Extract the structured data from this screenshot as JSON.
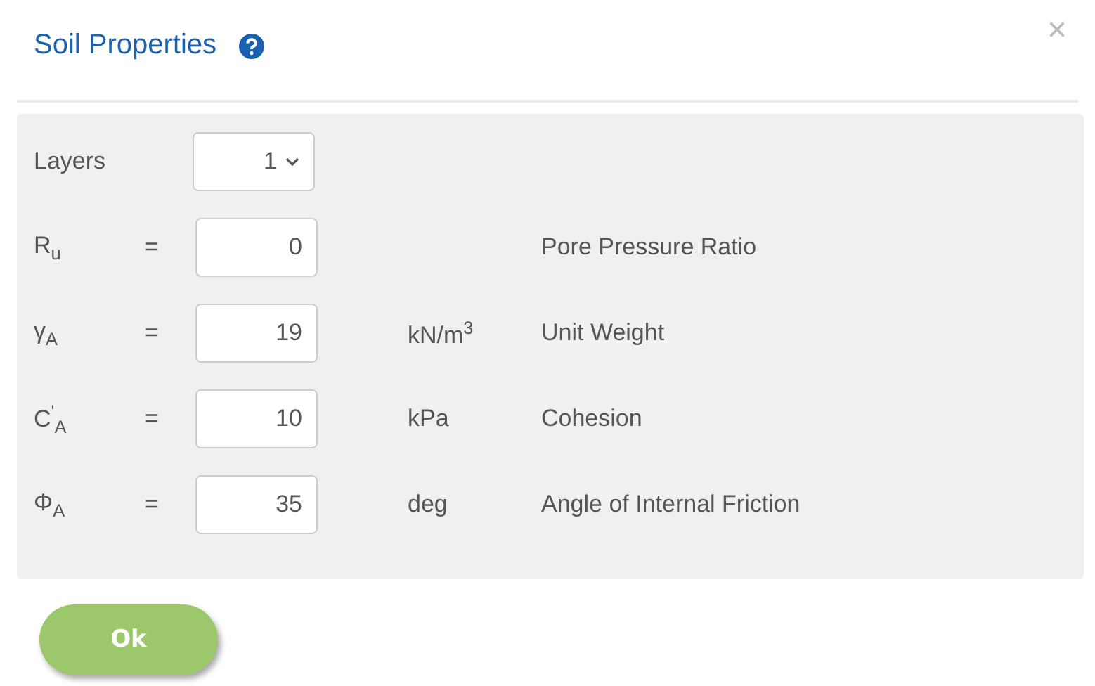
{
  "dialog": {
    "title": "Soil Properties",
    "close": "×"
  },
  "layers": {
    "label": "Layers",
    "value": "1"
  },
  "rows": [
    {
      "symbol": "R$_{u}$",
      "equals": "=",
      "value": "0",
      "description": "Pore Pressure Ratio"
    },
    {
      "symbol": "γ$_{A}$",
      "equals": "=",
      "value": "19",
      "unit": "kN/m$^{3}$",
      "description": "Unit Weight"
    },
    {
      "symbol": "C$^{'}$$_{A}$",
      "equals": "=",
      "value": "10",
      "unit": "kPa",
      "description": "Cohesion"
    },
    {
      "symbol": "Φ$_{A}$",
      "equals": "=",
      "value": "35",
      "unit": "deg",
      "description": "Angle of Internal Friction"
    }
  ],
  "buttons": [
    "Ok"
  ]
}
